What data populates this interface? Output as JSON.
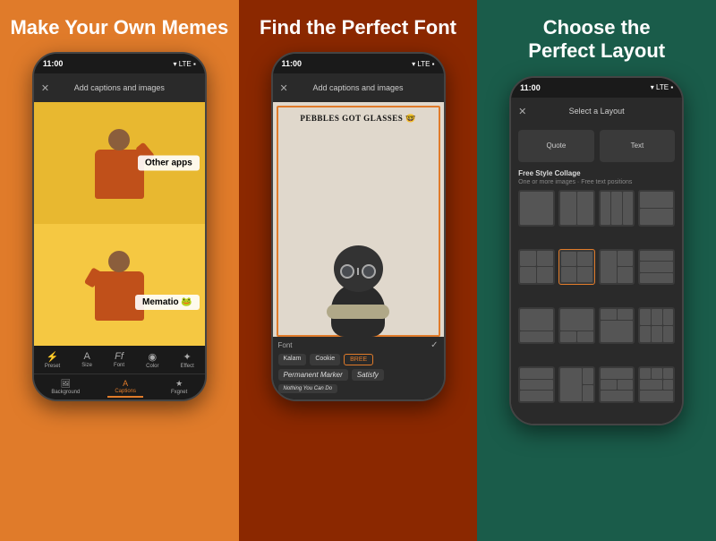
{
  "panels": [
    {
      "id": "panel-1",
      "title": "Make Your\nOwn Memes",
      "bg": "#E07B2A"
    },
    {
      "id": "panel-2",
      "title": "Find the\nPerfect Font",
      "bg": "#8B2800"
    },
    {
      "id": "panel-3",
      "title": "Choose the\nPerfect Layout",
      "bg": "#1A5C4A"
    }
  ],
  "phone1": {
    "status_time": "11:00",
    "status_icons": "▾ LTE ▪",
    "header_title": "Add captions\nand images",
    "header_close": "✕",
    "meme_top_label": "Other apps",
    "meme_bottom_label": "Mematio 🐸",
    "toolbar_icons": [
      {
        "symbol": "⚡",
        "label": "Preset",
        "active": false
      },
      {
        "symbol": "A",
        "label": "Size",
        "active": false
      },
      {
        "symbol": "Ff",
        "label": "Font",
        "active": false
      },
      {
        "symbol": "●",
        "label": "Color",
        "active": false
      },
      {
        "symbol": "✦",
        "label": "Effect",
        "active": false
      }
    ],
    "toolbar_tabs": [
      {
        "symbol": "🖼",
        "label": "Background",
        "active": false
      },
      {
        "symbol": "A",
        "label": "Captions",
        "active": true
      },
      {
        "symbol": "★",
        "label": "Fxgnet",
        "active": false
      }
    ]
  },
  "phone2": {
    "status_time": "11:00",
    "status_icons": "▾ LTE ▪",
    "header_title": "Add captions\nand images",
    "header_close": "✕",
    "pug_text": "PEBBLES GOT GLASSES 🤓",
    "font_label": "Font",
    "font_check": "✓",
    "font_options": [
      {
        "name": "Kalam",
        "active": false
      },
      {
        "name": "Cookie",
        "active": false
      },
      {
        "name": "BREE",
        "active": true
      },
      {
        "name": "Permanent\nMarker",
        "active": false,
        "handwritten": true
      },
      {
        "name": "Satisfy",
        "active": false,
        "handwritten": true
      },
      {
        "name": "Nothing You Can Do",
        "active": false,
        "handwritten": true
      }
    ]
  },
  "phone3": {
    "status_time": "11:00",
    "status_icons": "▾ LTE ▪",
    "header_title": "Select a Layout",
    "header_close": "✕",
    "top_options": [
      {
        "label": "Quote"
      },
      {
        "label": "Text"
      }
    ],
    "section_title": "Free Style Collage",
    "section_sub": "One or more images · Free text positions",
    "selected_layout_index": 5
  }
}
